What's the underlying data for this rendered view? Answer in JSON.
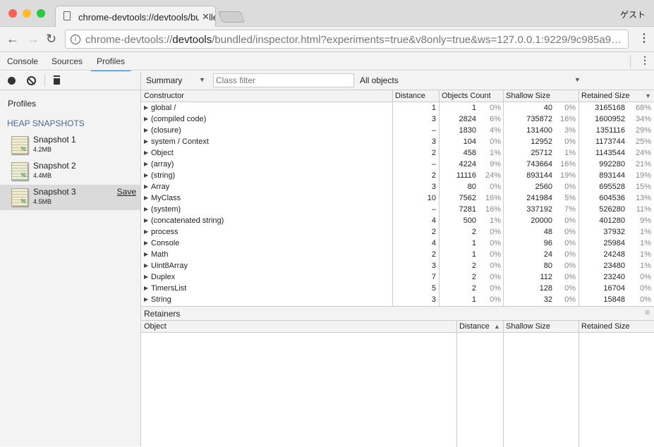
{
  "browser": {
    "tab_title": "chrome-devtools://devtools/bundled/inspector.html",
    "profile_label": "ゲスト",
    "url_prefix": "chrome-devtools://",
    "url_host": "devtools",
    "url_rest": "/bundled/inspector.html?experiments=true&v8only=true&ws=127.0.0.1:9229/9c985a9…"
  },
  "devtools": {
    "tabs": [
      {
        "label": "Console"
      },
      {
        "label": "Sources"
      },
      {
        "label": "Profiles",
        "active": true
      }
    ],
    "view_select": "Summary",
    "class_filter_placeholder": "Class filter",
    "objects_select": "All objects"
  },
  "sidebar": {
    "title": "Profiles",
    "section": "HEAP SNAPSHOTS",
    "snapshots": [
      {
        "name": "Snapshot 1",
        "size": "4.2MB"
      },
      {
        "name": "Snapshot 2",
        "size": "4.4MB"
      },
      {
        "name": "Snapshot 3",
        "size": "4.5MB",
        "selected": true,
        "action": "Save"
      }
    ]
  },
  "summary": {
    "columns": [
      "Constructor",
      "Distance",
      "Objects Count",
      "Shallow Size",
      "Retained Size"
    ],
    "sort_indicator": "▼",
    "rows": [
      [
        "global /",
        "1",
        "1",
        "0%",
        "40",
        "0%",
        "3165168",
        "68%"
      ],
      [
        "(compiled code)",
        "3",
        "2824",
        "6%",
        "735872",
        "16%",
        "1600952",
        "34%"
      ],
      [
        "(closure)",
        "–",
        "1830",
        "4%",
        "131400",
        "3%",
        "1351116",
        "29%"
      ],
      [
        "system / Context",
        "3",
        "104",
        "0%",
        "12952",
        "0%",
        "1173744",
        "25%"
      ],
      [
        "Object",
        "2",
        "458",
        "1%",
        "25712",
        "1%",
        "1143544",
        "24%"
      ],
      [
        "(array)",
        "–",
        "4224",
        "9%",
        "743664",
        "16%",
        "992280",
        "21%"
      ],
      [
        "(string)",
        "2",
        "11116",
        "24%",
        "893144",
        "19%",
        "893144",
        "19%"
      ],
      [
        "Array",
        "3",
        "80",
        "0%",
        "2560",
        "0%",
        "695528",
        "15%"
      ],
      [
        "MyClass",
        "10",
        "7562",
        "16%",
        "241984",
        "5%",
        "604536",
        "13%"
      ],
      [
        "(system)",
        "–",
        "7281",
        "16%",
        "337192",
        "7%",
        "526280",
        "11%"
      ],
      [
        "(concatenated string)",
        "4",
        "500",
        "1%",
        "20000",
        "0%",
        "401280",
        "9%"
      ],
      [
        "process",
        "2",
        "2",
        "0%",
        "48",
        "0%",
        "37932",
        "1%"
      ],
      [
        "Console",
        "4",
        "1",
        "0%",
        "96",
        "0%",
        "25984",
        "1%"
      ],
      [
        "Math",
        "2",
        "1",
        "0%",
        "24",
        "0%",
        "24248",
        "1%"
      ],
      [
        "Uint8Array",
        "3",
        "2",
        "0%",
        "80",
        "0%",
        "23480",
        "1%"
      ],
      [
        "Duplex",
        "7",
        "2",
        "0%",
        "112",
        "0%",
        "23240",
        "0%"
      ],
      [
        "TimersList",
        "5",
        "2",
        "0%",
        "128",
        "0%",
        "16704",
        "0%"
      ],
      [
        "String",
        "3",
        "1",
        "0%",
        "32",
        "0%",
        "15848",
        "0%"
      ]
    ]
  },
  "retainers": {
    "title": "Retainers",
    "columns": [
      "Object",
      "Distance",
      "Shallow Size",
      "Retained Size"
    ],
    "sort_indicator": "▲"
  }
}
